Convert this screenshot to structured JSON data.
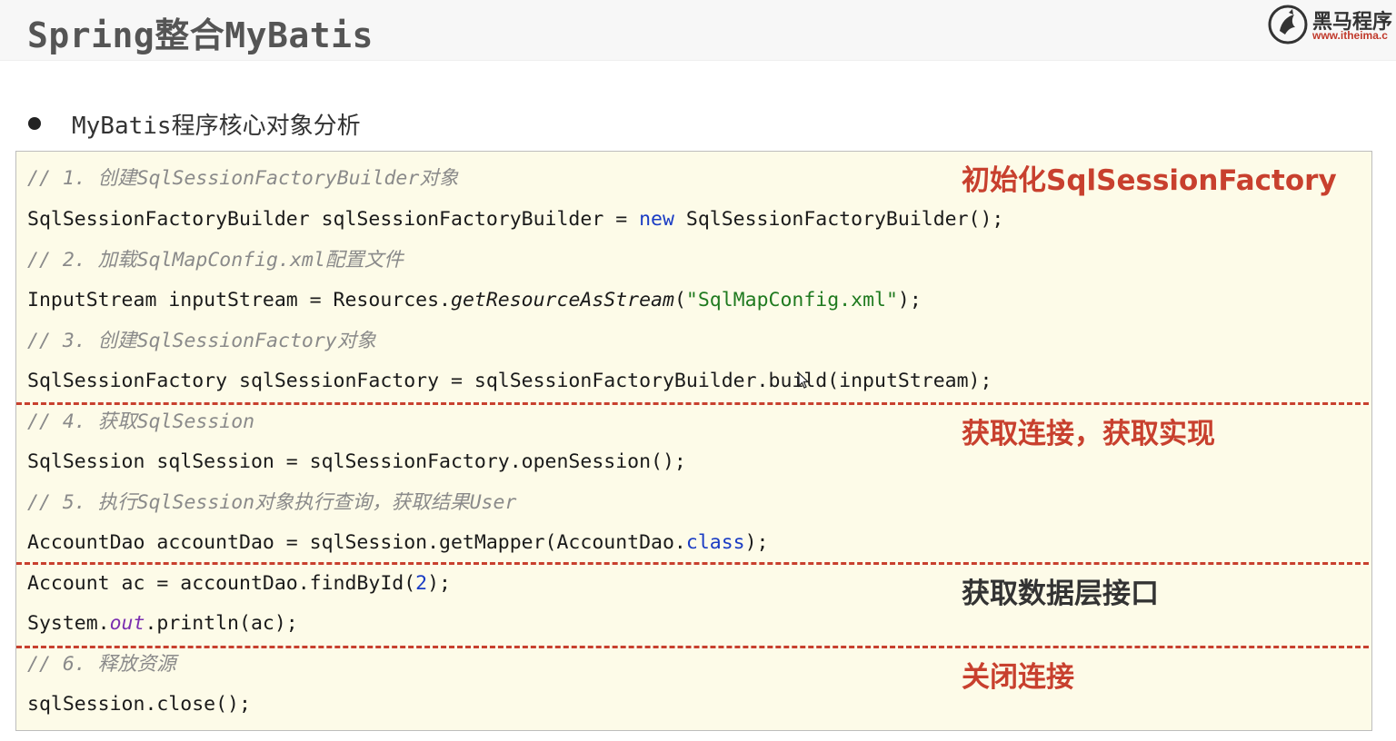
{
  "header": {
    "title": "Spring整合MyBatis",
    "logo": {
      "name": "黑马程序",
      "url": "www.itheima.c"
    }
  },
  "bullet": {
    "text": "MyBatis程序核心对象分析"
  },
  "code": {
    "c1": "// 1. 创建SqlSessionFactoryBuilder对象",
    "l1": {
      "a": "SqlSessionFactoryBuilder sqlSessionFactoryBuilder = ",
      "kw": "new",
      "b": " SqlSessionFactoryBuilder();"
    },
    "c2": "// 2. 加载SqlMapConfig.xml配置文件",
    "l2": {
      "a": "InputStream inputStream = Resources.",
      "method": "getResourceAsStream",
      "p1": "(",
      "str": "\"SqlMapConfig.xml\"",
      "p2": ");"
    },
    "c3": "// 3. 创建SqlSessionFactory对象",
    "l3": {
      "a": "SqlSessionFactory sqlSessionFactory = sqlSessionFactoryBuilder",
      "dot": ".",
      "b": "build(inputStream);"
    },
    "c4": "// 4. 获取SqlSession",
    "l4": "SqlSession sqlSession = sqlSessionFactory.openSession();",
    "c5": "// 5. 执行SqlSession对象执行查询，获取结果User",
    "l5": {
      "a": "AccountDao accountDao = sqlSession.getMapper(AccountDao.",
      "kw": "class",
      "b": ");"
    },
    "l6": {
      "a": "Account ac = accountDao.findById(",
      "num": "2",
      "b": ");"
    },
    "l7": {
      "a": "System.",
      "field": "out",
      "b": ".println(ac);"
    },
    "c6": "// 6. 释放资源",
    "l8": "sqlSession.close();"
  },
  "annotations": {
    "init": "初始化SqlSessionFactory",
    "get_conn": "获取连接，获取实现",
    "get_dao": "获取数据层接口",
    "close": "关闭连接"
  },
  "colors": {
    "annotation_red": "#c8402e",
    "annotation_dark": "#333333",
    "code_bg": "#fdfbe8",
    "comment": "#8a8a8a",
    "keyword": "#1a3cc4",
    "string": "#1f7a1f"
  }
}
